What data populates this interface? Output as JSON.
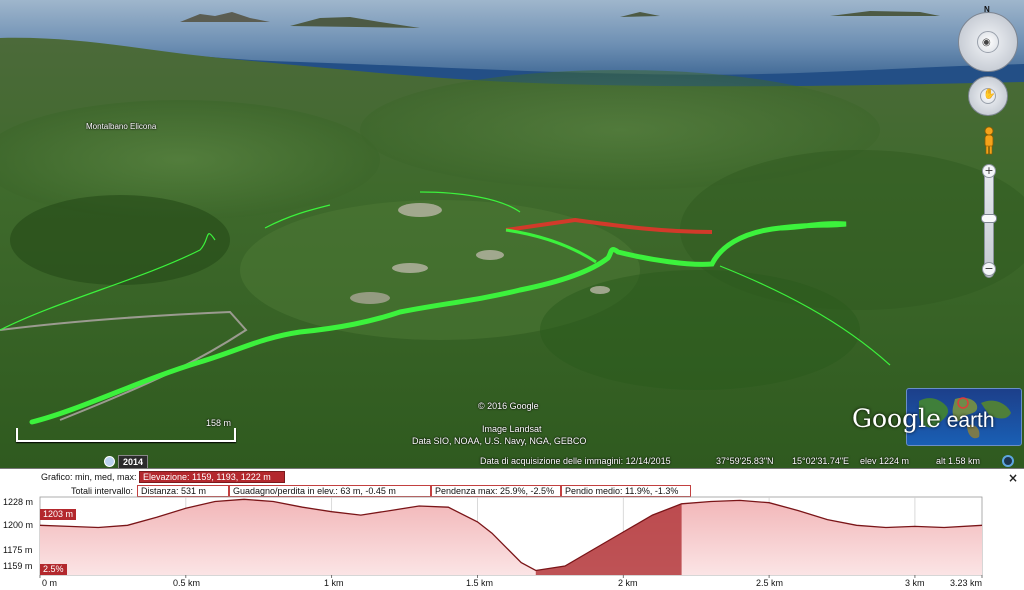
{
  "viewport": {
    "place_label": "Montalbano Elicona",
    "copyright": "© 2016 Google",
    "imagery_source": "Image Landsat",
    "data_sources": "Data SIO, NOAA, U.S. Navy, NGA, GEBCO",
    "scale_label": "158 m",
    "year": "2014",
    "status": {
      "acquisition": "Data di acquisizione delle immagini: 12/14/2015",
      "latitude": "37°59'25.83\"N",
      "longitude": "15°02'31.74\"E",
      "elevation": "elev  1224 m",
      "altitude": "alt  1.58 km"
    },
    "nav": {
      "north": "N",
      "zoom_in": "+",
      "zoom_out": "−"
    },
    "logo": {
      "word1": "Google",
      "word2": " earth"
    },
    "colors": {
      "track": "#3cf23c",
      "track_selected": "#d23a2a",
      "sea": "#5a7ea6"
    }
  },
  "profile": {
    "close_label": "×",
    "row1_label": "Grafico: min, med, max:",
    "row1_value": "Elevazione: 1159, 1193, 1222 m",
    "row2_label": "Totali intervallo:",
    "distance": "Distanza: 531 m",
    "gain_loss": "Guadagno/perdita in elev.: 63 m, -0.45 m",
    "slope_max": "Pendenza max: 25.9%, -2.5%",
    "slope_avg": "Pendio medio: 11.9%, -1.3%",
    "y_ticks": [
      "1228 m",
      "1200 m",
      "1175 m",
      "1159 m"
    ],
    "x_ticks": [
      "0 m",
      "0.5 km",
      "1 km",
      "1.5 km",
      "2 km",
      "2.5 km",
      "3 km",
      "3.23 km"
    ],
    "marker_elev": "1203 m",
    "marker_slope": "2.5%"
  },
  "chart_data": {
    "type": "area",
    "title": "",
    "xlabel": "",
    "ylabel": "",
    "x_unit": "km",
    "ylim": [
      1159,
      1228
    ],
    "xlim": [
      0,
      3.23
    ],
    "x": [
      0,
      0.1,
      0.2,
      0.3,
      0.4,
      0.5,
      0.6,
      0.7,
      0.8,
      0.9,
      1.0,
      1.1,
      1.2,
      1.3,
      1.4,
      1.5,
      1.55,
      1.6,
      1.65,
      1.7,
      1.8,
      1.9,
      2.0,
      2.1,
      2.2,
      2.3,
      2.4,
      2.5,
      2.6,
      2.7,
      2.8,
      2.9,
      3.0,
      3.1,
      3.23
    ],
    "y": [
      1203,
      1202,
      1201,
      1203,
      1210,
      1218,
      1224,
      1226,
      1224,
      1219,
      1215,
      1212,
      1216,
      1220,
      1219,
      1206,
      1196,
      1183,
      1170,
      1163,
      1167,
      1182,
      1197,
      1212,
      1222,
      1224,
      1225,
      1223,
      1216,
      1208,
      1203,
      1201,
      1202,
      1201,
      1203
    ],
    "selected_range": [
      1.7,
      2.2
    ]
  }
}
